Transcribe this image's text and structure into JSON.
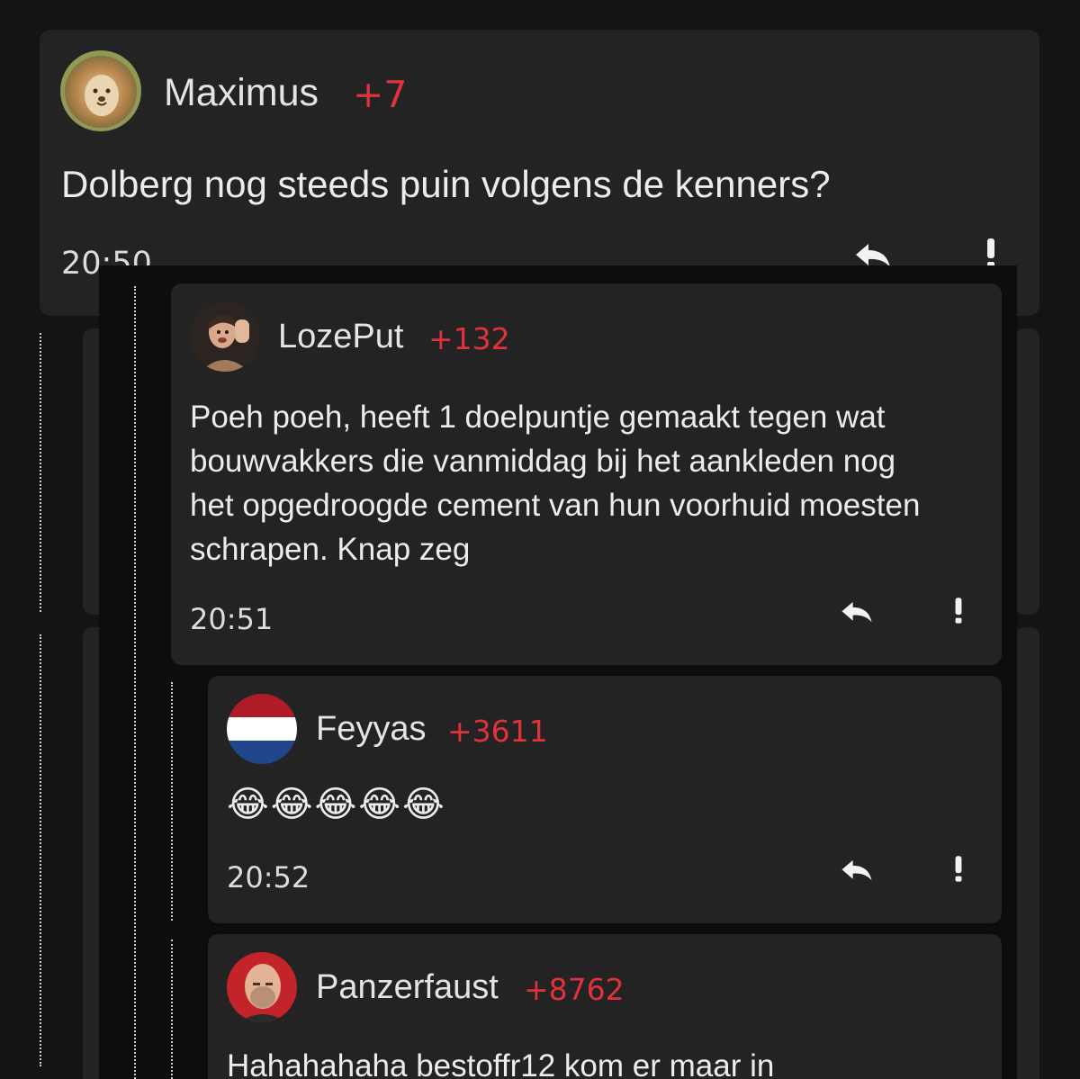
{
  "comments": [
    {
      "username": "Maximus",
      "score": "+7",
      "text": "Dolberg nog steeds puin volgens de kenners?",
      "time": "20:50",
      "avatar_icon": "lion-avatar"
    },
    {
      "username": "LozePut",
      "score": "+132",
      "text": "Poeh poeh, heeft 1 doelpuntje gemaakt tegen wat\nbouwvakkers die vanmiddag bij het aankleden nog\nhet opgedroogde cement van hun voorhuid moesten\nschrapen. Knap zeg",
      "time": "20:51",
      "avatar_icon": "person-photo-avatar"
    },
    {
      "username": "Feyyas",
      "score": "+3611",
      "text": "😂😂😂😂😂",
      "time": "20:52",
      "avatar_icon": "dutch-flag-avatar"
    },
    {
      "username": "Panzerfaust",
      "score": "+8762",
      "text": "Hahahahaha bestoffr12 kom er maar in",
      "avatar_icon": "bald-man-avatar"
    }
  ],
  "icons": {
    "reply": "reply-arrow-icon",
    "report": "exclamation-icon"
  },
  "colors": {
    "background": "#141414",
    "card": "#232323",
    "score": "#e0323d",
    "text": "#ececec"
  }
}
